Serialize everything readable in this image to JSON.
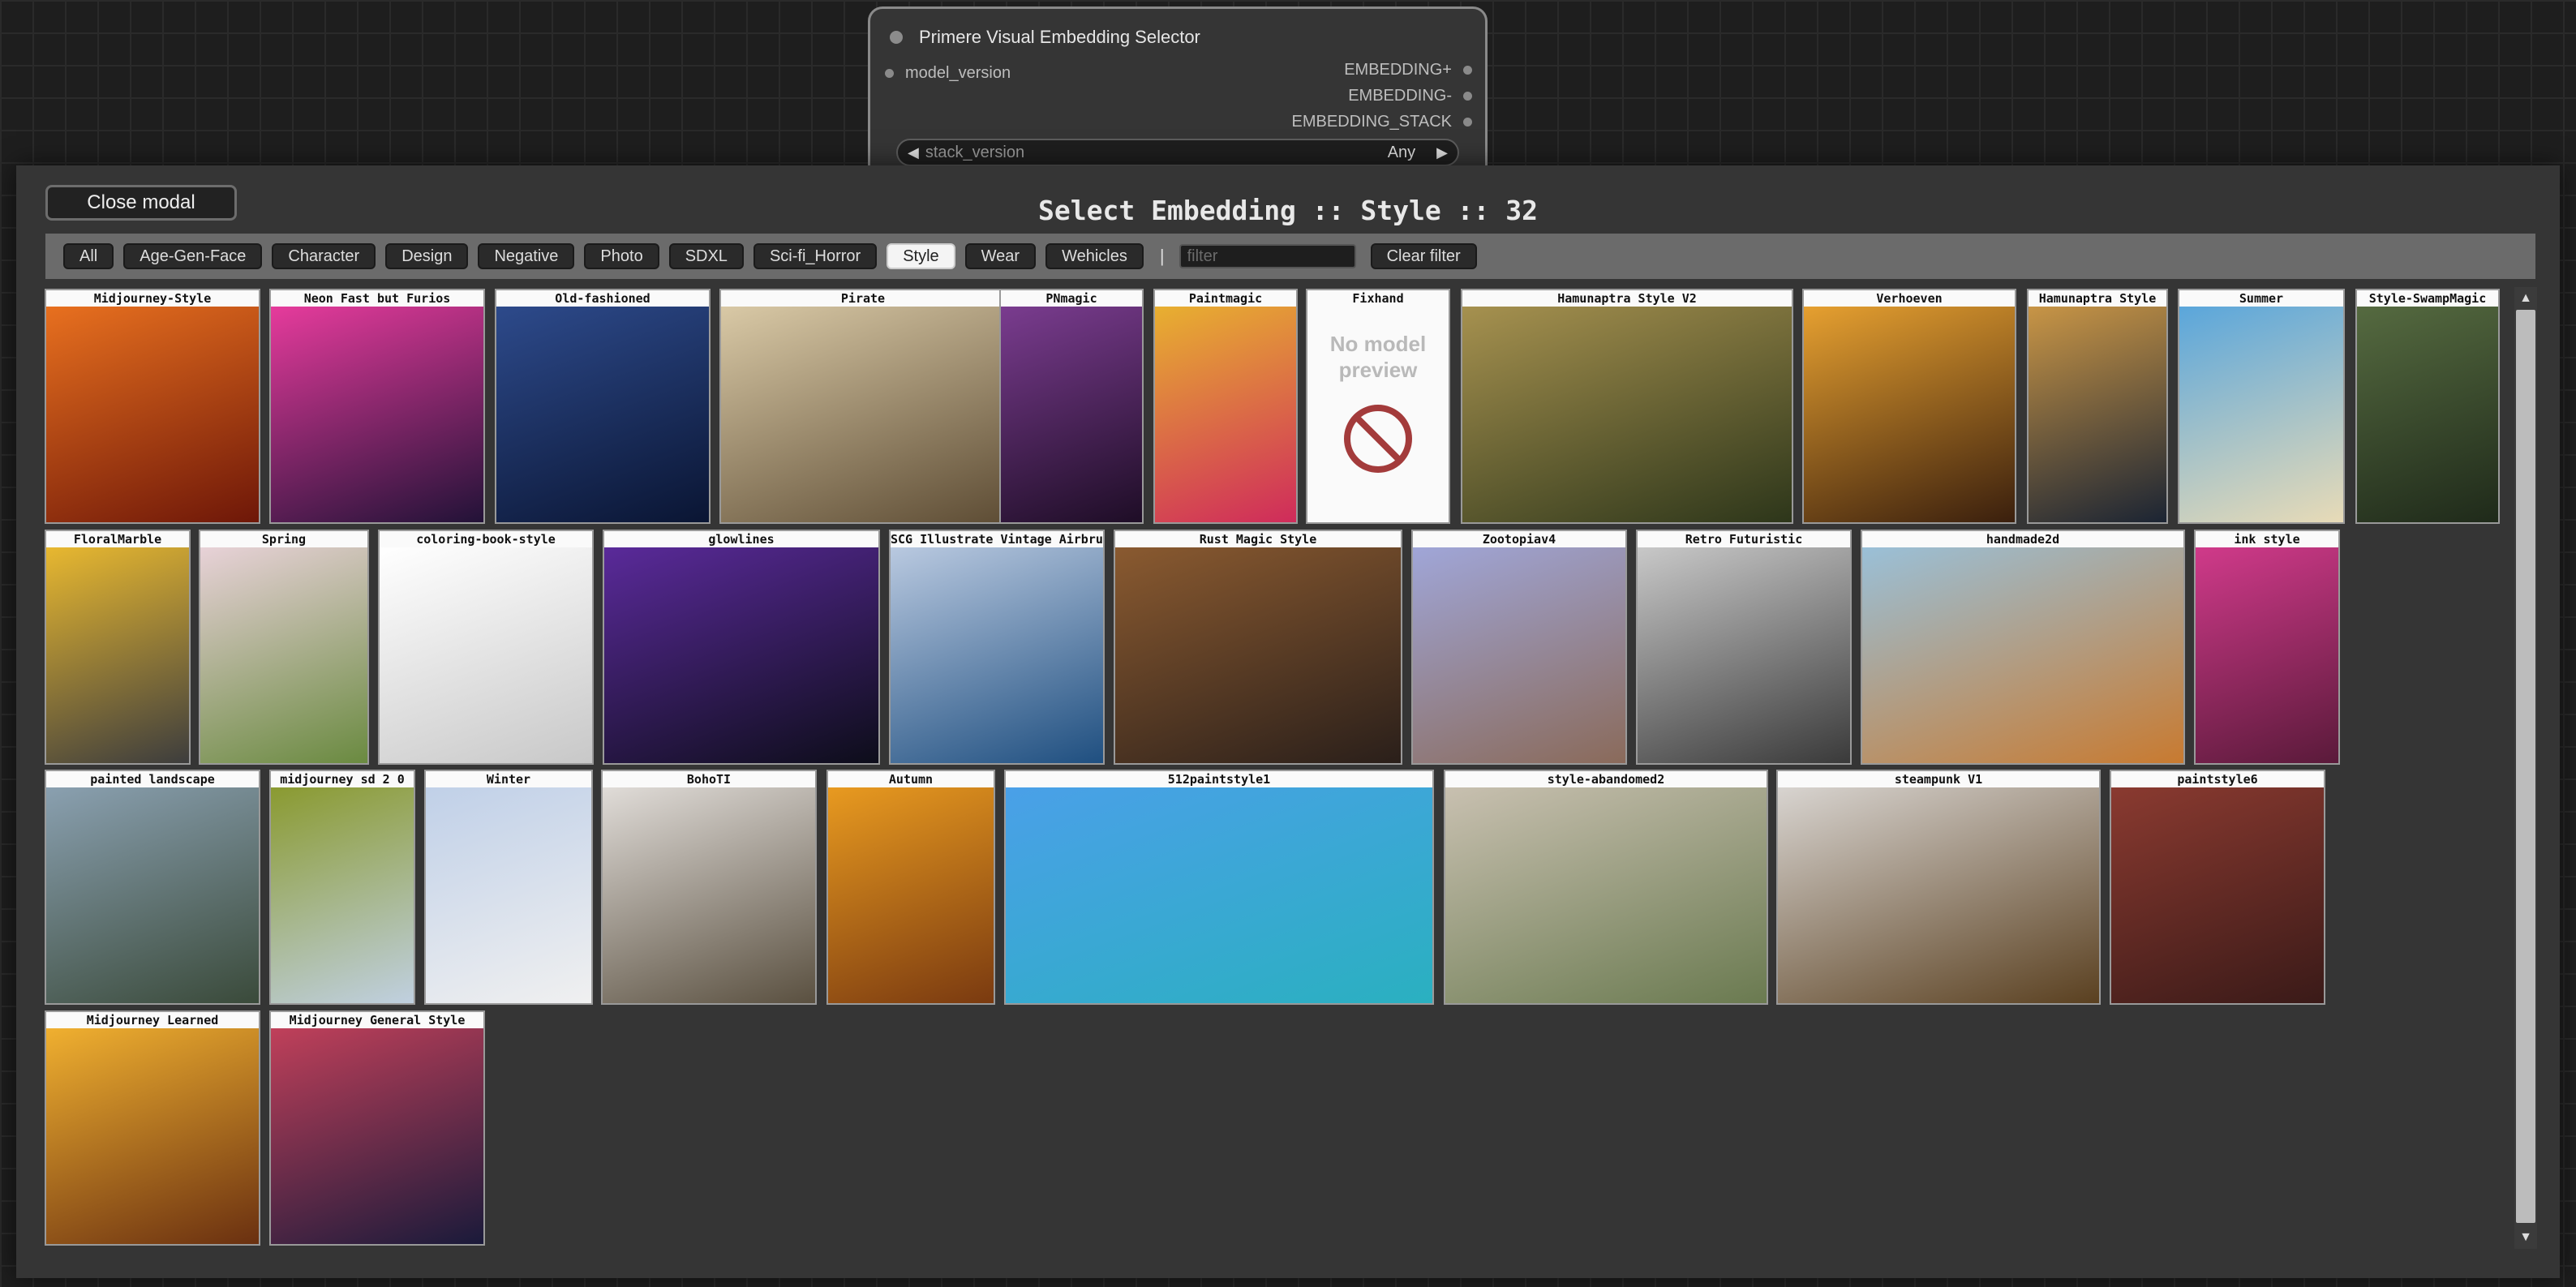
{
  "node": {
    "title": "Primere Visual Embedding Selector",
    "input_label": "model_version",
    "outputs": [
      "EMBEDDING+",
      "EMBEDDING-",
      "EMBEDDING_STACK"
    ],
    "widget_label": "stack_version",
    "widget_value": "Any"
  },
  "modal": {
    "close_label": "Close modal",
    "title": "Select Embedding :: Style :: 32",
    "filters": [
      "All",
      "Age-Gen-Face",
      "Character",
      "Design",
      "Negative",
      "Photo",
      "SDXL",
      "Sci-fi_Horror",
      "Style",
      "Wear",
      "Wehicles"
    ],
    "active_filter": "Style",
    "separator": "|",
    "filter_placeholder": "filter",
    "clear_label": "Clear filter",
    "no_preview_text_1": "No model",
    "no_preview_text_2": "preview"
  },
  "cards": [
    {
      "name": "Midjourney-Style",
      "colors": [
        "#e8701f",
        "#6e1708"
      ]
    },
    {
      "name": "Neon Fast but Furios",
      "colors": [
        "#e63b9c",
        "#221237"
      ]
    },
    {
      "name": "Old-fashioned",
      "colors": [
        "#2d4a8b",
        "#0a1533"
      ]
    },
    {
      "name": "Pirate",
      "colors": [
        "#d9c9a6",
        "#5e4d35"
      ]
    },
    {
      "name": "PNmagic",
      "colors": [
        "#7a3c8f",
        "#1e0d26"
      ]
    },
    {
      "name": "Paintmagic",
      "colors": [
        "#e8b030",
        "#cf2b5b"
      ]
    },
    {
      "name": "Fixhand",
      "no_preview": true
    },
    {
      "name": "Hamunaptra Style V2",
      "colors": [
        "#a6914f",
        "#2d361a"
      ]
    },
    {
      "name": "Verhoeven",
      "colors": [
        "#e6a030",
        "#3a1f0d"
      ]
    },
    {
      "name": "Hamunaptra Style",
      "colors": [
        "#c89546",
        "#1b2433"
      ]
    },
    {
      "name": "Summer",
      "colors": [
        "#5aa6db",
        "#e8dbb7"
      ]
    },
    {
      "name": "Style-SwampMagic",
      "colors": [
        "#556a40",
        "#1f2a1a"
      ]
    },
    {
      "name": "FloralMarble",
      "colors": [
        "#e8b830",
        "#3d3d3d"
      ]
    },
    {
      "name": "Spring",
      "colors": [
        "#e8d2d8",
        "#6a8a40"
      ]
    },
    {
      "name": "coloring-book-style",
      "colors": [
        "#ffffff",
        "#c8c8c8"
      ]
    },
    {
      "name": "glowlines",
      "colors": [
        "#5a2a9a",
        "#0d0d1a"
      ]
    },
    {
      "name": "SCG Illustrate Vintage Airbrush",
      "colors": [
        "#b9c9e0",
        "#1f4f80"
      ]
    },
    {
      "name": "Rust Magic Style",
      "colors": [
        "#8a5a30",
        "#2a1f1a"
      ]
    },
    {
      "name": "Zootopiav4",
      "colors": [
        "#a0a6d8",
        "#8a6a5a"
      ]
    },
    {
      "name": "Retro Futuristic",
      "colors": [
        "#c8c8c8",
        "#3a3a3a"
      ]
    },
    {
      "name": "handmade2d",
      "colors": [
        "#9ac0d8",
        "#c87a30"
      ]
    },
    {
      "name": "ink style",
      "colors": [
        "#d03a8a",
        "#5a1a3a"
      ]
    },
    {
      "name": "painted landscape",
      "colors": [
        "#8aa0b0",
        "#3a4a3a"
      ]
    },
    {
      "name": "midjourney sd 2 0",
      "colors": [
        "#8a9a30",
        "#c0d0e0"
      ]
    },
    {
      "name": "Winter",
      "colors": [
        "#c0d0e8",
        "#f0f0f0"
      ]
    },
    {
      "name": "BohoTI",
      "colors": [
        "#e0dcd8",
        "#5a5040"
      ]
    },
    {
      "name": "Autumn",
      "colors": [
        "#e89a20",
        "#7a3a10"
      ]
    },
    {
      "name": "512paintstyle1",
      "colors": [
        "#4aa0e8",
        "#2ab0c0"
      ]
    },
    {
      "name": "style-abandomed2",
      "colors": [
        "#c8c0b0",
        "#6a7a50"
      ]
    },
    {
      "name": "steampunk V1",
      "colors": [
        "#d8d4d0",
        "#5a4020"
      ]
    },
    {
      "name": "paintstyle6",
      "colors": [
        "#8a3a30",
        "#3a1a18"
      ]
    },
    {
      "name": "Midjourney Learned",
      "colors": [
        "#f0b030",
        "#6a3010"
      ]
    },
    {
      "name": "Midjourney General Style",
      "colors": [
        "#c0405a",
        "#1a1a3a"
      ]
    }
  ]
}
